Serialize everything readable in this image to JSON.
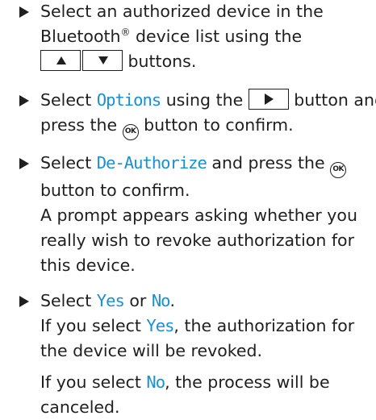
{
  "steps": [
    {
      "a": "Select an authorized device in the Bluetooth",
      "reg": "®",
      "b": " device list using the",
      "c": " buttons."
    },
    {
      "a": "Select ",
      "hl": "Options",
      "b": " using the ",
      "c": " button and press the ",
      "ok": "OK",
      "d": " button to confirm."
    },
    {
      "a": "Select ",
      "hl": "De-Authorize",
      "b": " and press the ",
      "ok": "OK",
      "c": " button to confirm.",
      "result": "A prompt appears asking whether you really wish to revoke authorization for this device."
    },
    {
      "a": "Select ",
      "hl_yes": "Yes",
      "b": " or ",
      "hl_no": "No",
      "c": ".",
      "r1a": "If you select ",
      "r1b": ", the authorization for the device will be revoked.",
      "r2a": "If you select ",
      "r2b": ", the process will be canceled."
    }
  ],
  "colors": {
    "highlight": "#1a8fd1",
    "text": "#1f1f1f"
  },
  "icons": [
    "bullet-triangle-icon",
    "up-arrow-icon",
    "down-arrow-icon",
    "right-arrow-icon",
    "ok-button-icon"
  ]
}
